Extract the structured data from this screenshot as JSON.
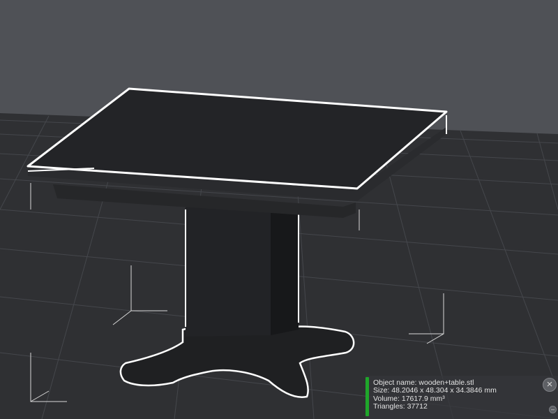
{
  "viewport": {
    "background": "#4f5156",
    "plate_color": "#2f3033",
    "grid_color": "#44464b",
    "model_color": "#1f2022",
    "outline_color": "#ffffff"
  },
  "object_info": {
    "name_line": "Object name: wooden+table.stl",
    "size_line": "Size: 48.2046 x 48.304 x 34.3846 mm",
    "volume_line": "Volume: 17617.9 mm³",
    "triangles_line": "Triangles: 37712",
    "accent_color": "#1fa62a"
  },
  "controls": {
    "close_icon": "×",
    "collapse_icon": "–"
  }
}
